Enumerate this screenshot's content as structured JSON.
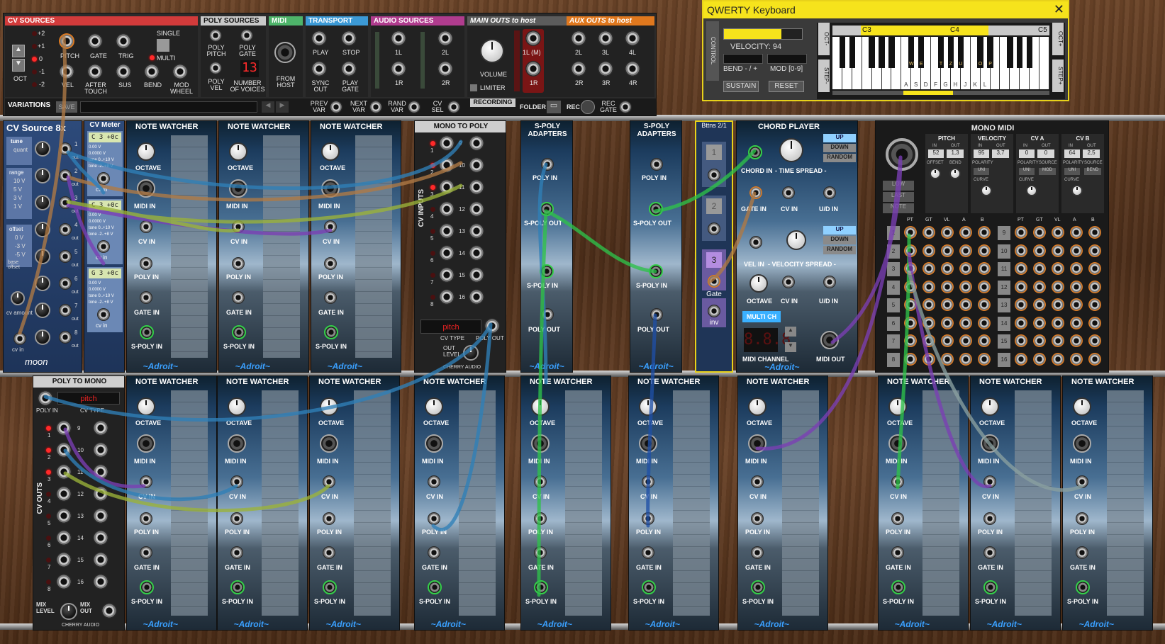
{
  "host": {
    "cv_sources": {
      "title": "CV SOURCES",
      "octave_values": [
        "+2",
        "+1",
        "0",
        "-1",
        "-2"
      ],
      "oct_label": "OCT",
      "labels": [
        "PITCH",
        "GATE",
        "TRIG",
        "VEL",
        "AFTER TOUCH",
        "SUS",
        "BEND",
        "MOD WHEEL"
      ],
      "single": "SINGLE",
      "multi": "MULTI"
    },
    "poly_sources": {
      "title": "POLY SOURCES",
      "labels": [
        "POLY PITCH",
        "POLY GATE",
        "POLY VEL",
        "NUMBER OF VOICES"
      ],
      "voices": "13"
    },
    "midi": {
      "title": "MIDI",
      "from_host": "FROM HOST"
    },
    "transport": {
      "title": "TRANSPORT",
      "labels": [
        "PLAY",
        "STOP",
        "SYNC OUT",
        "PLAY GATE"
      ]
    },
    "audio_sources": {
      "title": "AUDIO SOURCES",
      "labels": [
        "1L",
        "2L",
        "1R",
        "2R"
      ]
    },
    "main_outs": {
      "title": "MAIN OUTS to host",
      "volume": "VOLUME",
      "limiter": "LIMITER",
      "labels": [
        "1L (M)",
        "1R"
      ]
    },
    "aux_outs": {
      "title": "AUX OUTS to host",
      "labels": [
        "2L",
        "3L",
        "4L",
        "2R",
        "3R",
        "4R"
      ]
    },
    "variations": {
      "title": "VARIATIONS",
      "save": "SAVE",
      "labels": [
        "PREV VAR",
        "NEXT VAR",
        "RAND VAR",
        "CV SEL"
      ]
    },
    "recording": {
      "title": "RECORDING",
      "folder": "FOLDER",
      "rec": "REC",
      "rec_gate": "REC GATE"
    }
  },
  "qwerty": {
    "title": "QWERTY Keyboard",
    "control": "CONTROL",
    "velocity": "VELOCITY: 94",
    "velocity_fraction": 0.74,
    "bend": "BEND - / +",
    "mod": "MOD [0-9]",
    "sustain": "SUSTAIN",
    "reset": "RESET",
    "oct_minus": "OCT-",
    "oct_plus": "OCT+",
    "step_minus": "STEP-",
    "step_plus": "STEP+",
    "octave_labels": [
      "C3",
      "C4",
      "C5"
    ],
    "white_key_letters": [
      "A",
      "S",
      "D",
      "F",
      "G",
      "H",
      "J",
      "K",
      "L"
    ],
    "black_key_letters": [
      "W",
      "E",
      "T",
      "Z",
      "U",
      "O",
      "P"
    ]
  },
  "cv_source_8x": {
    "title": "CV Source 8x",
    "tune": "tune",
    "quant": "quant",
    "range": "range",
    "ranges": [
      "10 V",
      "5 V",
      "3 V",
      "1 V"
    ],
    "offset": "offset",
    "offsets": [
      "0 V",
      "-3 V",
      "-5 V"
    ],
    "base_offset": "base offset",
    "cv_amount": "cv amount",
    "cv_in": "cv in",
    "brand": "moon",
    "outs": [
      "1",
      "2",
      "3",
      "4",
      "5",
      "6",
      "7",
      "8"
    ],
    "out": "out"
  },
  "cv_meter": {
    "title": "CV Meter",
    "displays": [
      "C 3 +0c",
      "C 3 +0c",
      "G 3 +0c"
    ],
    "cv_in": "cv in",
    "rows": [
      "0.00 V",
      "0.0000 V",
      "tone 0..+10 V",
      "tone -2..+8 V"
    ]
  },
  "note_watcher": {
    "title": "NOTE WATCHER",
    "octave": "OCTAVE",
    "midi_in": "MIDI IN",
    "cv_in": "CV IN",
    "poly_in": "POLY IN",
    "gate_in": "GATE IN",
    "spoly_in": "S-POLY IN",
    "brand": "~Adroit~"
  },
  "mono_to_poly": {
    "title": "MONO TO POLY",
    "side": "CV INPUTS",
    "inputs": [
      "1",
      "2",
      "3",
      "4",
      "5",
      "6",
      "7",
      "8",
      "9",
      "10",
      "11",
      "12",
      "13",
      "14",
      "15",
      "16"
    ],
    "cv_type": "CV TYPE",
    "cv_type_value": "pitch",
    "poly_out": "POLY OUT",
    "out_level": "OUT LEVEL",
    "brand": "CHERRY AUDIO"
  },
  "spoly": {
    "title": "S-POLY ADAPTERS",
    "poly_in": "POLY IN",
    "spoly_out": "S-POLY OUT",
    "spoly_in": "S-POLY IN",
    "poly_out": "POLY OUT"
  },
  "buttons": {
    "title": "Bttns 2/1",
    "b1": "1",
    "b2": "2",
    "b3": "3",
    "gate": "Gate",
    "inv": "inv"
  },
  "chord_player": {
    "title": "CHORD PLAYER",
    "chord_in": "CHORD IN",
    "gate_in": "GATE IN",
    "vel_in": "VEL IN",
    "time_spread": "- TIME SPREAD -",
    "velocity_spread": "- VELOCITY SPREAD -",
    "cv_in": "CV IN",
    "ud_in": "U/D IN",
    "octave": "OCTAVE",
    "up": "UP",
    "down": "DOWN",
    "random": "RANDOM",
    "multi_ch": "MULTI CH",
    "midi_channel": "MIDI CHANNEL",
    "channel_display": "8.8.8",
    "midi_out": "MIDI OUT",
    "brand": "~Adroit~"
  },
  "mono_midi": {
    "title": "MONO MIDI",
    "sections": [
      "PITCH",
      "VELOCITY",
      "CV A",
      "CV B"
    ],
    "in": "IN",
    "out": "OUT",
    "values": [
      "52",
      "1,3",
      "95",
      "3,7",
      "0",
      "0",
      "64",
      "2,5"
    ],
    "offset": "OFFSET",
    "bend": "BEND",
    "polarity": "POLARITY",
    "source": "SOURCE",
    "curve": "CURVE",
    "uni": "UNI",
    "mod": "MOD",
    "bend_btn": "BEND",
    "modes": [
      "LOW",
      "LAST",
      "NOTE"
    ],
    "col_headers": [
      "PT",
      "GT",
      "VL",
      "A",
      "B"
    ],
    "rows_left": [
      "1",
      "2",
      "3",
      "4",
      "5",
      "6",
      "7",
      "8"
    ],
    "rows_right": [
      "9",
      "10",
      "11",
      "12",
      "13",
      "14",
      "15",
      "16"
    ]
  },
  "poly_to_mono": {
    "title": "POLY TO MONO",
    "poly_in": "POLY IN",
    "cv_type": "CV TYPE",
    "cv_type_value": "pitch",
    "side": "CV OUTS",
    "outs": [
      "1",
      "2",
      "3",
      "4",
      "5",
      "6",
      "7",
      "8",
      "9",
      "10",
      "11",
      "12",
      "13",
      "14",
      "15",
      "16"
    ],
    "mix_level": "MIX LEVEL",
    "mix_out": "MIX OUT",
    "brand": "CHERRY AUDIO"
  },
  "colors": {
    "cv_header": "#d23b3b",
    "poly_header": "#c9c9c9",
    "midi_header": "#4eb46a",
    "transport_header": "#3c9ad6",
    "audio_header": "#b03c8e",
    "main_header": "#6a6a6a",
    "aux_header": "#e0781e",
    "cable_blue": "#2f80b8",
    "cable_green": "#2ec24a",
    "cable_purple": "#7b3fb5",
    "cable_olive": "#9bb33a",
    "cable_brown": "#b07a45",
    "cable_navy": "#1f4fa6"
  }
}
